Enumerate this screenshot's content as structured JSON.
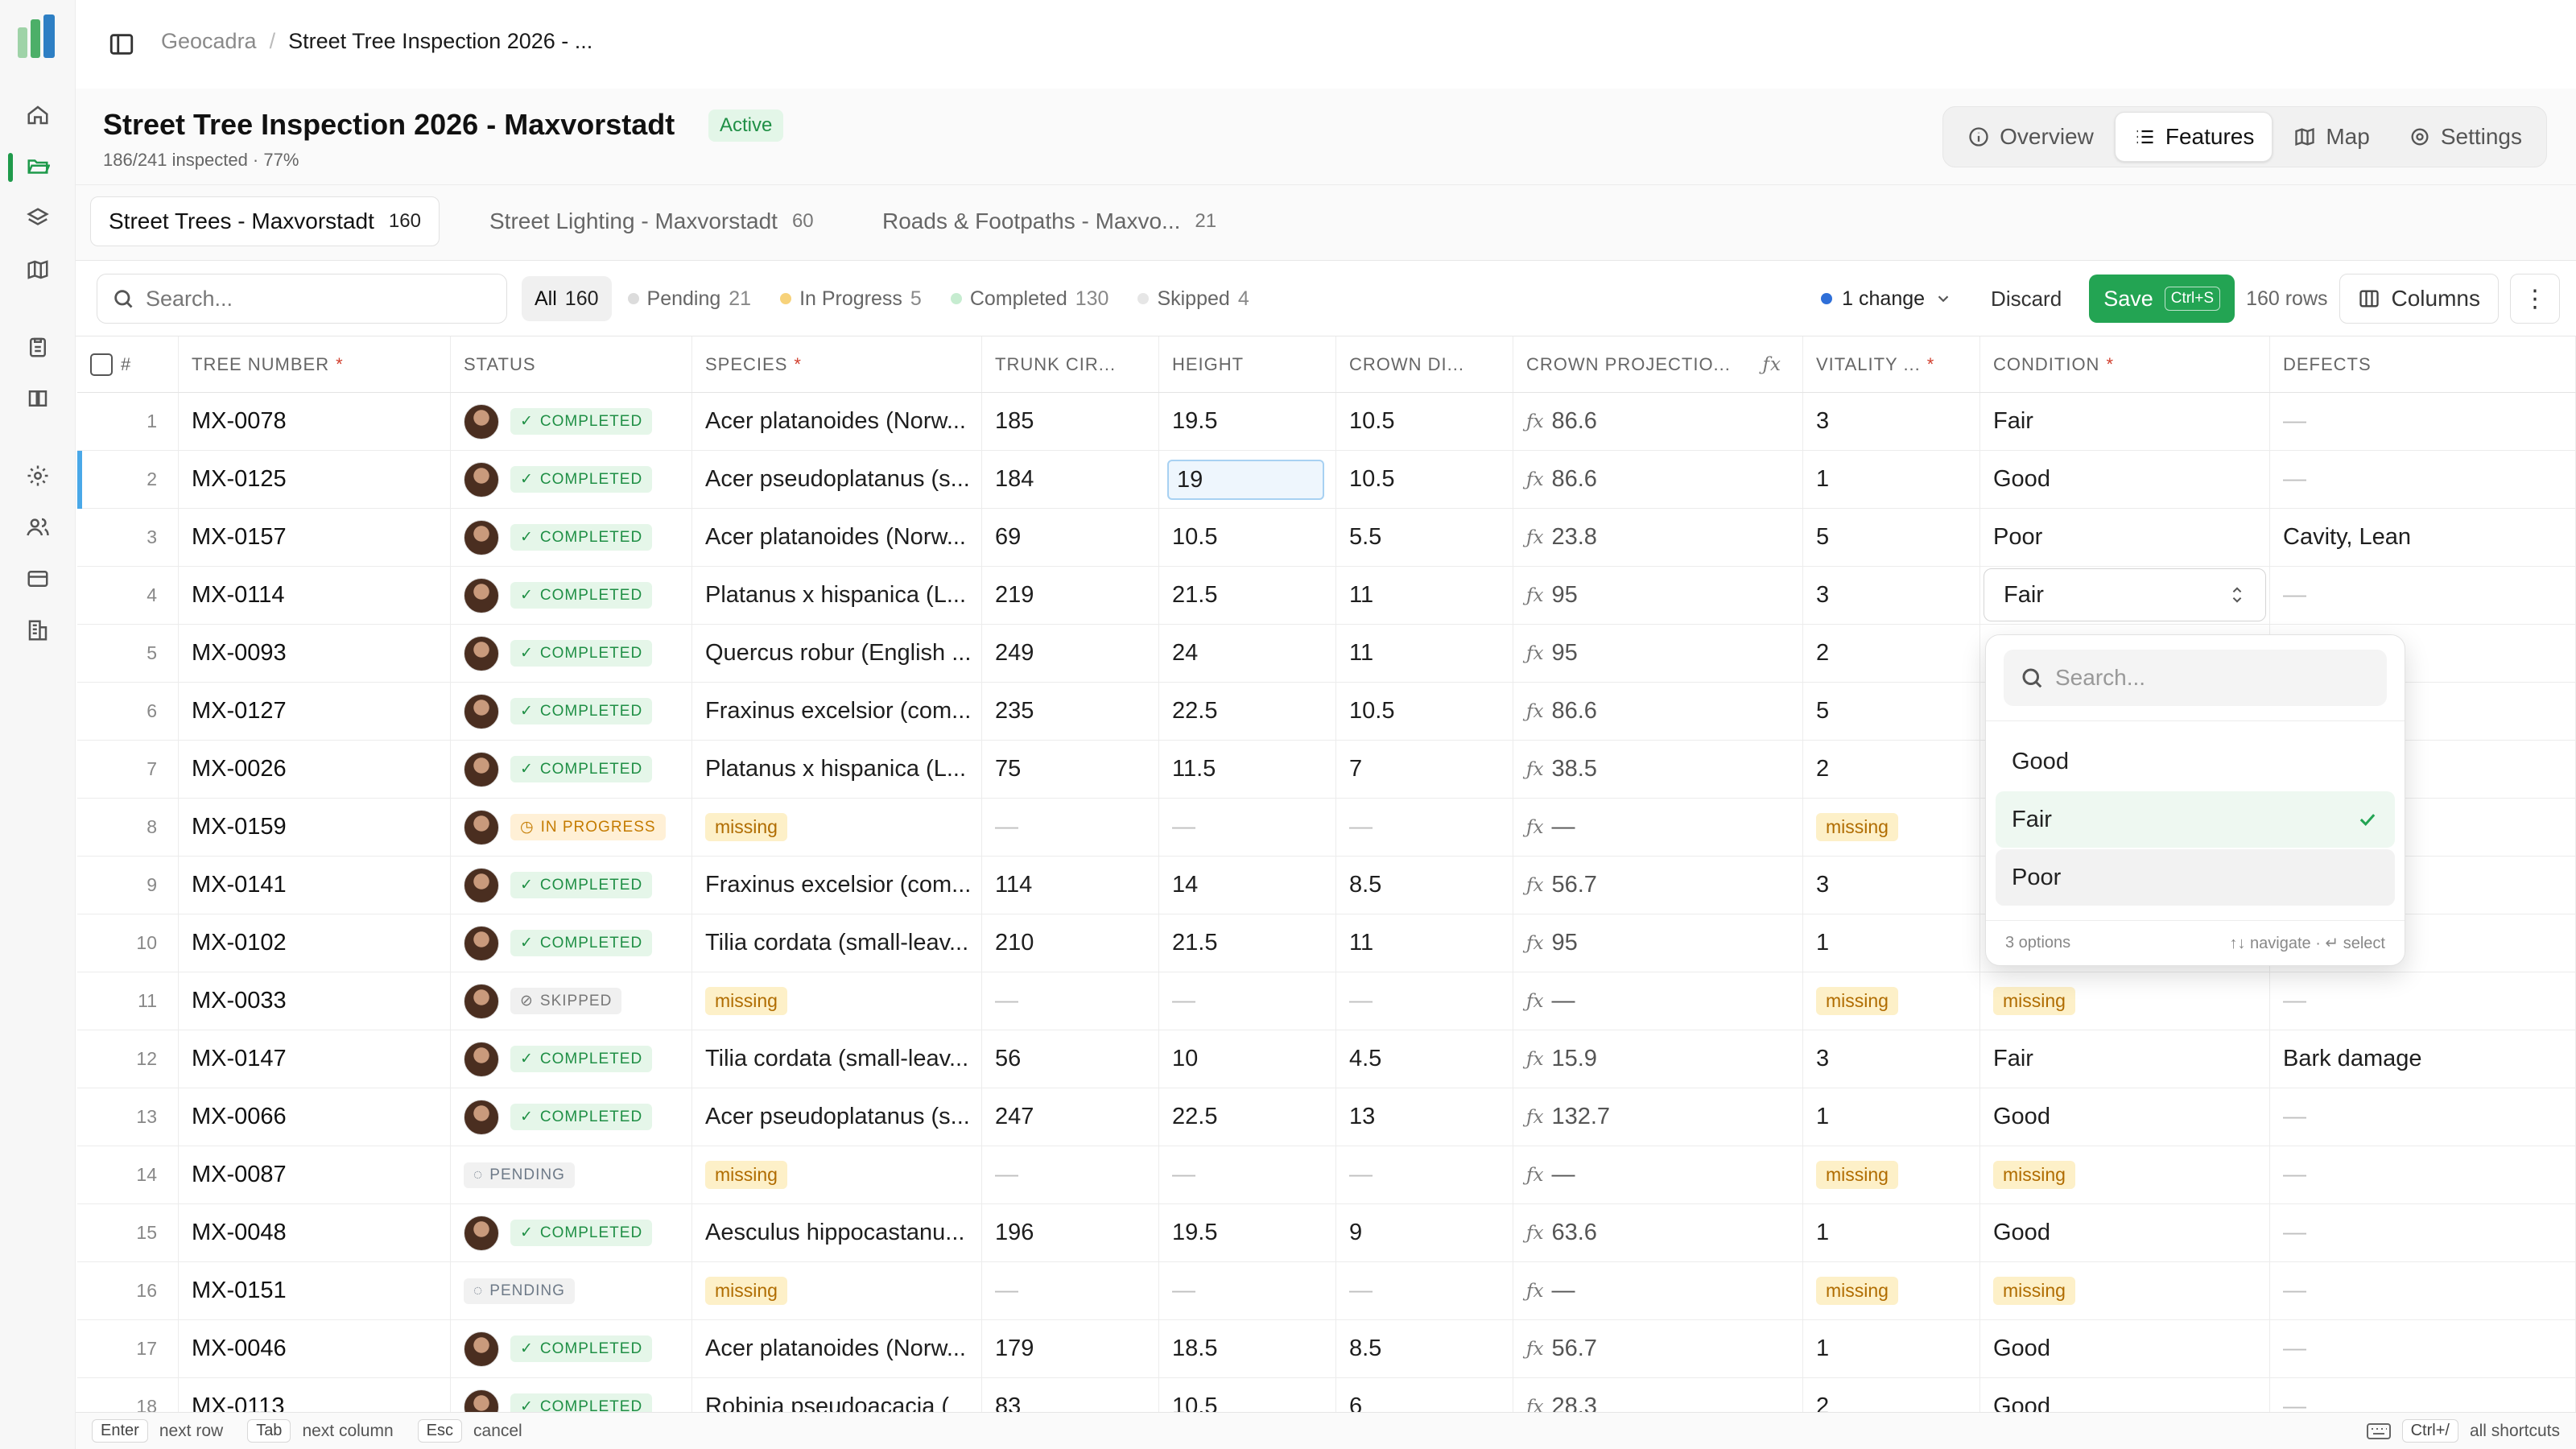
{
  "breadcrumb": {
    "root": "Geocadra",
    "sep": "/",
    "current": "Street Tree Inspection 2026 - ..."
  },
  "project": {
    "title": "Street Tree Inspection 2026 - Maxvorstadt",
    "status": "Active",
    "progress_text": "186/241 inspected · 77%",
    "progress_fraction": 0.77
  },
  "views": [
    {
      "label": "Overview",
      "icon": "info-icon"
    },
    {
      "label": "Features",
      "icon": "list-icon"
    },
    {
      "label": "Map",
      "icon": "map-icon"
    },
    {
      "label": "Settings",
      "icon": "gear-icon"
    }
  ],
  "active_view": "Features",
  "layers": [
    {
      "label": "Street Trees - Maxvorstadt",
      "count": "160"
    },
    {
      "label": "Street Lighting - Maxvorstadt",
      "count": "60"
    },
    {
      "label": "Roads & Footpaths - Maxvo...",
      "count": "21"
    }
  ],
  "toolbar": {
    "search_placeholder": "Search...",
    "filters": [
      {
        "label": "All",
        "count": "160",
        "color": ""
      },
      {
        "label": "Pending",
        "count": "21",
        "color": "#d8d8d8"
      },
      {
        "label": "In Progress",
        "count": "5",
        "color": "#f5c451"
      },
      {
        "label": "Completed",
        "count": "130",
        "color": "#bfe8c8"
      },
      {
        "label": "Skipped",
        "count": "4",
        "color": "#e2e2e2"
      }
    ],
    "changes": "1 change",
    "discard": "Discard",
    "save": "Save",
    "save_shortcut": "Ctrl+S",
    "rows": "160 rows",
    "columns": "Columns",
    "more": "⋮"
  },
  "columns": {
    "num": "#",
    "tree_number": "TREE NUMBER",
    "status": "STATUS",
    "species": "SPECIES",
    "trunk": "TRUNK CIR...",
    "height": "HEIGHT",
    "crown_di": "CROWN DI...",
    "crown_proj": "CROWN PROJECTIO...",
    "vitality": "VITALITY ...",
    "condition": "CONDITION",
    "defects": "DEFECTS",
    "required_mark": "*",
    "fx": "ƒx"
  },
  "rows": [
    {
      "n": "1",
      "id": "MX-0078",
      "status": "COMPLETED",
      "species": "Acer platanoides (Norw...",
      "trunk": "185",
      "height": "19.5",
      "crown": "10.5",
      "proj": "86.6",
      "vitality": "3",
      "condition": "Fair",
      "defects": "—"
    },
    {
      "n": "2",
      "id": "MX-0125",
      "status": "COMPLETED",
      "species": "Acer pseudoplatanus (s...",
      "trunk": "184",
      "height": "19",
      "crown": "10.5",
      "proj": "86.6",
      "vitality": "1",
      "condition": "Good",
      "defects": "—"
    },
    {
      "n": "3",
      "id": "MX-0157",
      "status": "COMPLETED",
      "species": "Acer platanoides (Norw...",
      "trunk": "69",
      "height": "10.5",
      "crown": "5.5",
      "proj": "23.8",
      "vitality": "5",
      "condition": "Poor",
      "defects": "Cavity, Lean"
    },
    {
      "n": "4",
      "id": "MX-0114",
      "status": "COMPLETED",
      "species": "Platanus x hispanica (L...",
      "trunk": "219",
      "height": "21.5",
      "crown": "11",
      "proj": "95",
      "vitality": "3",
      "condition": "Fair",
      "defects": "—"
    },
    {
      "n": "5",
      "id": "MX-0093",
      "status": "COMPLETED",
      "species": "Quercus robur (English ...",
      "trunk": "249",
      "height": "24",
      "crown": "11",
      "proj": "95",
      "vitality": "2",
      "condition": "",
      "defects": ""
    },
    {
      "n": "6",
      "id": "MX-0127",
      "status": "COMPLETED",
      "species": "Fraxinus excelsior (com...",
      "trunk": "235",
      "height": "22.5",
      "crown": "10.5",
      "proj": "86.6",
      "vitality": "5",
      "condition": "",
      "defects": "dwood"
    },
    {
      "n": "7",
      "id": "MX-0026",
      "status": "COMPLETED",
      "species": "Platanus x hispanica (L...",
      "trunk": "75",
      "height": "11.5",
      "crown": "7",
      "proj": "38.5",
      "vitality": "2",
      "condition": "",
      "defects": ""
    },
    {
      "n": "8",
      "id": "MX-0159",
      "status": "IN PROGRESS",
      "species": "missing",
      "trunk": "—",
      "height": "—",
      "crown": "—",
      "proj": "—",
      "vitality": "missing",
      "condition": "",
      "defects": ""
    },
    {
      "n": "9",
      "id": "MX-0141",
      "status": "COMPLETED",
      "species": "Fraxinus excelsior (com...",
      "trunk": "114",
      "height": "14",
      "crown": "8.5",
      "proj": "56.7",
      "vitality": "3",
      "condition": "",
      "defects": "ing bodies"
    },
    {
      "n": "10",
      "id": "MX-0102",
      "status": "COMPLETED",
      "species": "Tilia cordata (small-leav...",
      "trunk": "210",
      "height": "21.5",
      "crown": "11",
      "proj": "95",
      "vitality": "1",
      "condition": "",
      "defects": ""
    },
    {
      "n": "11",
      "id": "MX-0033",
      "status": "SKIPPED",
      "species": "missing",
      "trunk": "—",
      "height": "—",
      "crown": "—",
      "proj": "—",
      "vitality": "missing",
      "condition": "missing",
      "defects": "—"
    },
    {
      "n": "12",
      "id": "MX-0147",
      "status": "COMPLETED",
      "species": "Tilia cordata (small-leav...",
      "trunk": "56",
      "height": "10",
      "crown": "4.5",
      "proj": "15.9",
      "vitality": "3",
      "condition": "Fair",
      "defects": "Bark damage"
    },
    {
      "n": "13",
      "id": "MX-0066",
      "status": "COMPLETED",
      "species": "Acer pseudoplatanus (s...",
      "trunk": "247",
      "height": "22.5",
      "crown": "13",
      "proj": "132.7",
      "vitality": "1",
      "condition": "Good",
      "defects": "—"
    },
    {
      "n": "14",
      "id": "MX-0087",
      "status": "PENDING",
      "species": "missing",
      "trunk": "—",
      "height": "—",
      "crown": "—",
      "proj": "—",
      "vitality": "missing",
      "condition": "missing",
      "defects": "—"
    },
    {
      "n": "15",
      "id": "MX-0048",
      "status": "COMPLETED",
      "species": "Aesculus hippocastanu...",
      "trunk": "196",
      "height": "19.5",
      "crown": "9",
      "proj": "63.6",
      "vitality": "1",
      "condition": "Good",
      "defects": "—"
    },
    {
      "n": "16",
      "id": "MX-0151",
      "status": "PENDING",
      "species": "missing",
      "trunk": "—",
      "height": "—",
      "crown": "—",
      "proj": "—",
      "vitality": "missing",
      "condition": "missing",
      "defects": "—"
    },
    {
      "n": "17",
      "id": "MX-0046",
      "status": "COMPLETED",
      "species": "Acer platanoides (Norw...",
      "trunk": "179",
      "height": "18.5",
      "crown": "8.5",
      "proj": "56.7",
      "vitality": "1",
      "condition": "Good",
      "defects": "—"
    },
    {
      "n": "18",
      "id": "MX-0113",
      "status": "COMPLETED",
      "species": "Robinia pseudoacacia (",
      "trunk": "83",
      "height": "10.5",
      "crown": "6",
      "proj": "28.3",
      "vitality": "2",
      "condition": "Good",
      "defects": "—"
    }
  ],
  "dropdown": {
    "search_placeholder": "Search...",
    "options": [
      "Good",
      "Fair",
      "Poor"
    ],
    "selected": "Fair",
    "hovered": "Poor",
    "count_text": "3 options",
    "nav_hint": "↑↓ navigate · ↵ select"
  },
  "hints": [
    {
      "key": "Enter",
      "label": "next row"
    },
    {
      "key": "Tab",
      "label": "next column"
    },
    {
      "key": "Esc",
      "label": "cancel"
    }
  ],
  "shortcuts": {
    "key": "Ctrl+/",
    "label": "all shortcuts"
  },
  "colors": {
    "accent": "#23a453",
    "selection": "#4aa8e8",
    "missing_bg": "#fdf0c8"
  }
}
